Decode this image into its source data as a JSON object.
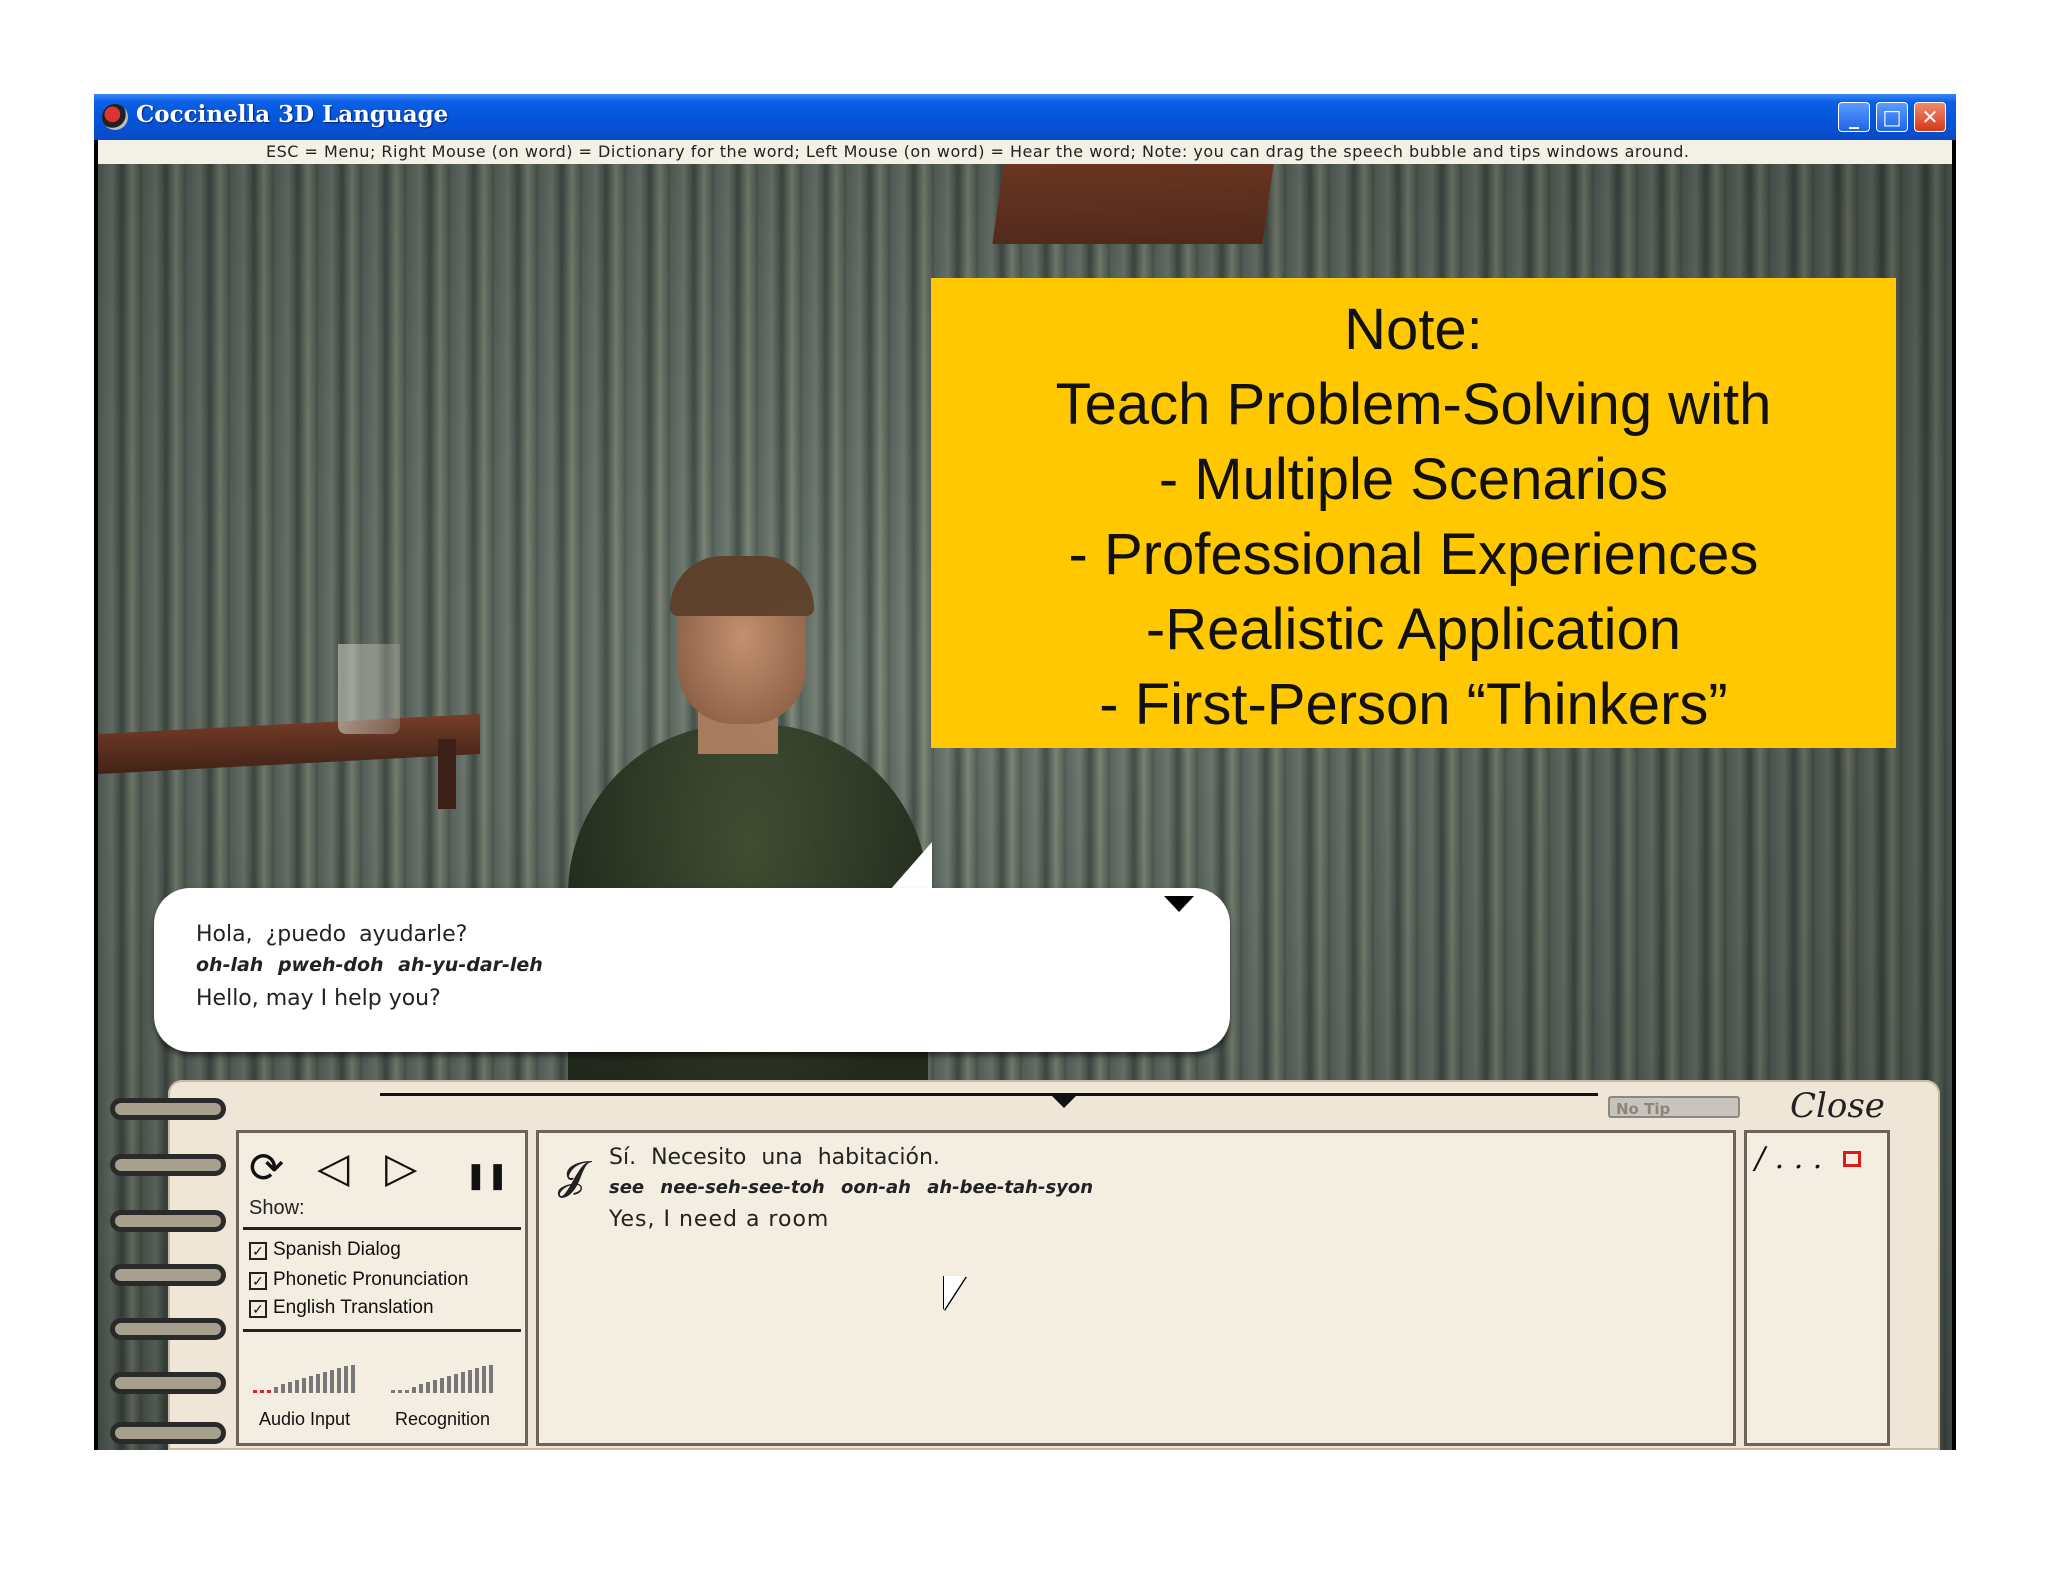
{
  "window": {
    "title": "Coccinella 3D Language",
    "buttons": {
      "minimize": "_",
      "maximize": "□",
      "close": "✕"
    },
    "hint_bar": "ESC = Menu;   Right Mouse (on word) = Dictionary for the word;   Left Mouse (on word) = Hear the word;   Note: you can drag the speech bubble and tips windows around."
  },
  "note": {
    "lines": [
      "Note:",
      "Teach Problem-Solving with",
      "- Multiple Scenarios",
      "- Professional Experiences",
      "-Realistic Application",
      "- First-Person “Thinkers”"
    ]
  },
  "speech_bubble": {
    "spanish": "Hola, ¿puedo ayudarle?",
    "phonetic": "oh-lah pweh-doh ah-yu-dar-leh",
    "english": "Hello, may I help you?"
  },
  "notebook": {
    "no_tip": "No Tip",
    "close": "Close",
    "controls": {
      "replay_icon": "⟳",
      "back_icon": "◁",
      "play_icon": "▷",
      "pause_icon": "❚❚",
      "show_label": "Show:",
      "options": [
        {
          "label": "Spanish Dialog",
          "checked": true
        },
        {
          "label": "Phonetic Pronunciation",
          "checked": true
        },
        {
          "label": "English Translation",
          "checked": true
        }
      ],
      "audio_input": "Audio Input",
      "recognition": "Recognition"
    },
    "dialog": {
      "ear_icon": "ear-icon",
      "spanish": "Sí. Necesito una habitación.",
      "phonetic": "see nee-seh-see-toh oon-ah ah-bee-tah-syon",
      "english": "Yes, I need a room"
    },
    "tips": {
      "text": "/ . . ."
    }
  },
  "colors": {
    "note_background": "#ffc800",
    "titlebar": "#0454d8",
    "notebook": "#efe6d8"
  }
}
